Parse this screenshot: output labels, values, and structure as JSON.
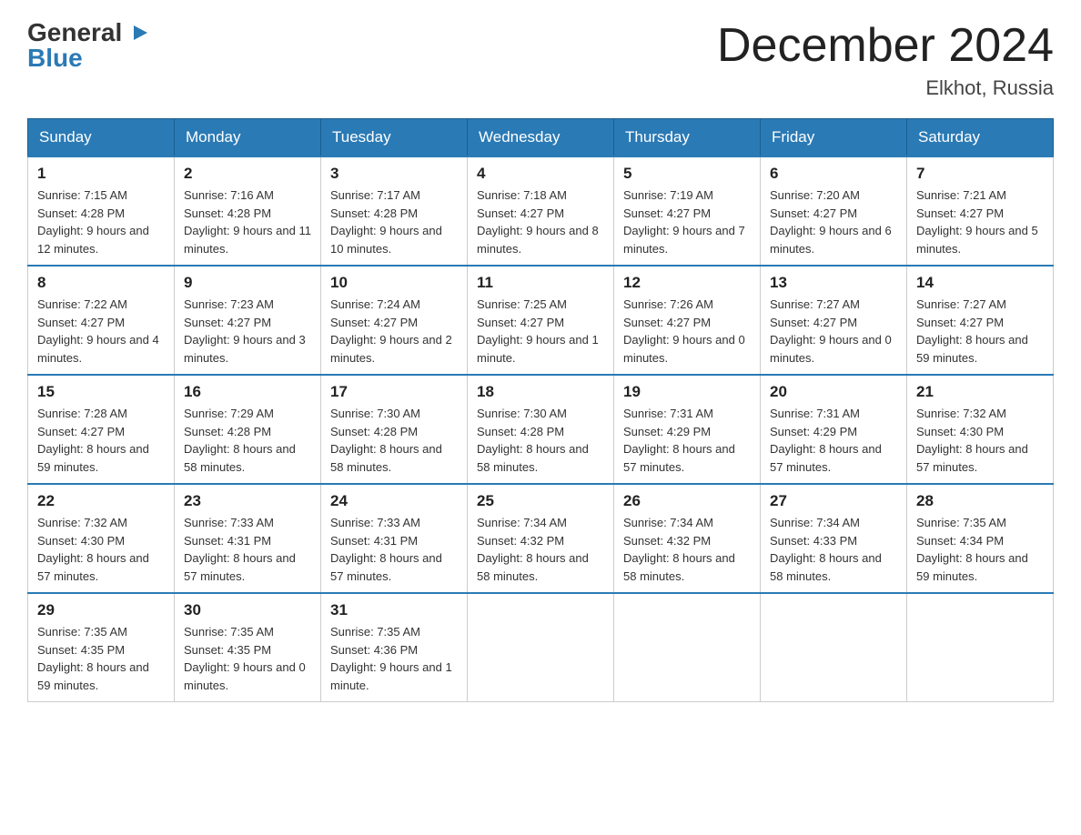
{
  "header": {
    "logo": {
      "general": "General",
      "blue": "Blue",
      "triangle_symbol": "▶"
    },
    "title": "December 2024",
    "subtitle": "Elkhot, Russia"
  },
  "weekdays": [
    "Sunday",
    "Monday",
    "Tuesday",
    "Wednesday",
    "Thursday",
    "Friday",
    "Saturday"
  ],
  "weeks": [
    [
      {
        "day": "1",
        "sunrise": "7:15 AM",
        "sunset": "4:28 PM",
        "daylight": "9 hours and 12 minutes."
      },
      {
        "day": "2",
        "sunrise": "7:16 AM",
        "sunset": "4:28 PM",
        "daylight": "9 hours and 11 minutes."
      },
      {
        "day": "3",
        "sunrise": "7:17 AM",
        "sunset": "4:28 PM",
        "daylight": "9 hours and 10 minutes."
      },
      {
        "day": "4",
        "sunrise": "7:18 AM",
        "sunset": "4:27 PM",
        "daylight": "9 hours and 8 minutes."
      },
      {
        "day": "5",
        "sunrise": "7:19 AM",
        "sunset": "4:27 PM",
        "daylight": "9 hours and 7 minutes."
      },
      {
        "day": "6",
        "sunrise": "7:20 AM",
        "sunset": "4:27 PM",
        "daylight": "9 hours and 6 minutes."
      },
      {
        "day": "7",
        "sunrise": "7:21 AM",
        "sunset": "4:27 PM",
        "daylight": "9 hours and 5 minutes."
      }
    ],
    [
      {
        "day": "8",
        "sunrise": "7:22 AM",
        "sunset": "4:27 PM",
        "daylight": "9 hours and 4 minutes."
      },
      {
        "day": "9",
        "sunrise": "7:23 AM",
        "sunset": "4:27 PM",
        "daylight": "9 hours and 3 minutes."
      },
      {
        "day": "10",
        "sunrise": "7:24 AM",
        "sunset": "4:27 PM",
        "daylight": "9 hours and 2 minutes."
      },
      {
        "day": "11",
        "sunrise": "7:25 AM",
        "sunset": "4:27 PM",
        "daylight": "9 hours and 1 minute."
      },
      {
        "day": "12",
        "sunrise": "7:26 AM",
        "sunset": "4:27 PM",
        "daylight": "9 hours and 0 minutes."
      },
      {
        "day": "13",
        "sunrise": "7:27 AM",
        "sunset": "4:27 PM",
        "daylight": "9 hours and 0 minutes."
      },
      {
        "day": "14",
        "sunrise": "7:27 AM",
        "sunset": "4:27 PM",
        "daylight": "8 hours and 59 minutes."
      }
    ],
    [
      {
        "day": "15",
        "sunrise": "7:28 AM",
        "sunset": "4:27 PM",
        "daylight": "8 hours and 59 minutes."
      },
      {
        "day": "16",
        "sunrise": "7:29 AM",
        "sunset": "4:28 PM",
        "daylight": "8 hours and 58 minutes."
      },
      {
        "day": "17",
        "sunrise": "7:30 AM",
        "sunset": "4:28 PM",
        "daylight": "8 hours and 58 minutes."
      },
      {
        "day": "18",
        "sunrise": "7:30 AM",
        "sunset": "4:28 PM",
        "daylight": "8 hours and 58 minutes."
      },
      {
        "day": "19",
        "sunrise": "7:31 AM",
        "sunset": "4:29 PM",
        "daylight": "8 hours and 57 minutes."
      },
      {
        "day": "20",
        "sunrise": "7:31 AM",
        "sunset": "4:29 PM",
        "daylight": "8 hours and 57 minutes."
      },
      {
        "day": "21",
        "sunrise": "7:32 AM",
        "sunset": "4:30 PM",
        "daylight": "8 hours and 57 minutes."
      }
    ],
    [
      {
        "day": "22",
        "sunrise": "7:32 AM",
        "sunset": "4:30 PM",
        "daylight": "8 hours and 57 minutes."
      },
      {
        "day": "23",
        "sunrise": "7:33 AM",
        "sunset": "4:31 PM",
        "daylight": "8 hours and 57 minutes."
      },
      {
        "day": "24",
        "sunrise": "7:33 AM",
        "sunset": "4:31 PM",
        "daylight": "8 hours and 57 minutes."
      },
      {
        "day": "25",
        "sunrise": "7:34 AM",
        "sunset": "4:32 PM",
        "daylight": "8 hours and 58 minutes."
      },
      {
        "day": "26",
        "sunrise": "7:34 AM",
        "sunset": "4:32 PM",
        "daylight": "8 hours and 58 minutes."
      },
      {
        "day": "27",
        "sunrise": "7:34 AM",
        "sunset": "4:33 PM",
        "daylight": "8 hours and 58 minutes."
      },
      {
        "day": "28",
        "sunrise": "7:35 AM",
        "sunset": "4:34 PM",
        "daylight": "8 hours and 59 minutes."
      }
    ],
    [
      {
        "day": "29",
        "sunrise": "7:35 AM",
        "sunset": "4:35 PM",
        "daylight": "8 hours and 59 minutes."
      },
      {
        "day": "30",
        "sunrise": "7:35 AM",
        "sunset": "4:35 PM",
        "daylight": "9 hours and 0 minutes."
      },
      {
        "day": "31",
        "sunrise": "7:35 AM",
        "sunset": "4:36 PM",
        "daylight": "9 hours and 1 minute."
      },
      null,
      null,
      null,
      null
    ]
  ],
  "labels": {
    "sunrise": "Sunrise: ",
    "sunset": "Sunset: ",
    "daylight": "Daylight: "
  }
}
